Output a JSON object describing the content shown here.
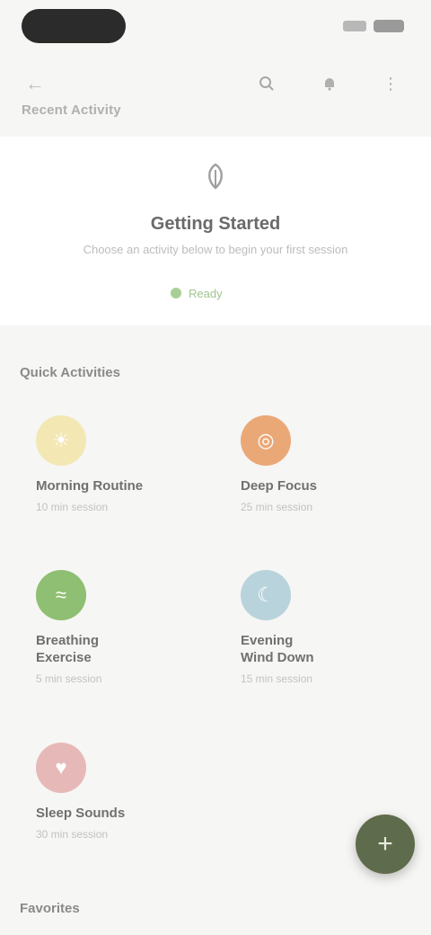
{
  "toolbar": {
    "title": "Recent Activity"
  },
  "card": {
    "title": "Getting Started",
    "subtitle": "Choose an activity below to begin your first session",
    "chip_label": "Ready"
  },
  "sections": {
    "activities_title": "Quick Activities",
    "more_title": "Favorites"
  },
  "activities": [
    {
      "title": "Morning Routine",
      "subtitle": "10 min session",
      "color": "#f3e7b4"
    },
    {
      "title": "Deep Focus",
      "subtitle": "25 min session",
      "color": "#eba877"
    },
    {
      "title": "Breathing\nExercise",
      "subtitle": "5 min session",
      "color": "#8fbf72"
    },
    {
      "title": "Evening\nWind Down",
      "subtitle": "15 min session",
      "color": "#b9d3dc"
    },
    {
      "title": "Sleep Sounds",
      "subtitle": "30 min session",
      "color": "#e6b9b8"
    }
  ],
  "icons": {
    "back": "arrow-left-icon",
    "search": "search-icon",
    "bell": "bell-icon",
    "more": "more-icon",
    "card": "leaf-icon",
    "fab": "plus-icon"
  }
}
